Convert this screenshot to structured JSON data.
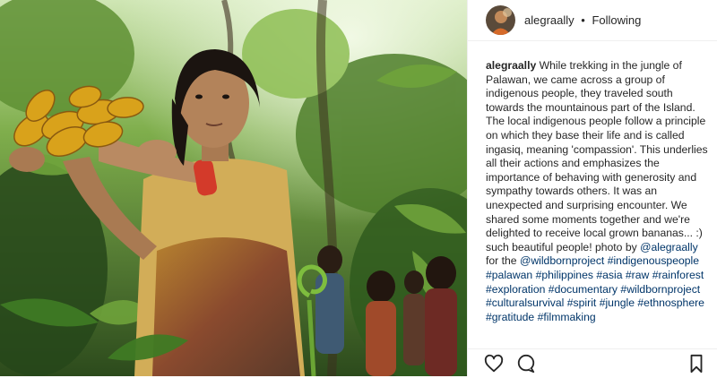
{
  "post": {
    "username": "alegraally",
    "follow_status": "Following",
    "separator": "•"
  },
  "caption": {
    "username": "alegraally",
    "text_a": "While trekking in the jungle of Palawan, we came across a group of indigenous people, they traveled south towards the mountainous part of the Island. The local indigenous people follow a principle on which they base their life and is called ingasiq, meaning 'compassion'. This underlies all their actions and emphasizes the importance of behaving with generosity and sympathy towards others. It was an unexpected and surprising encounter. We shared some moments together and we're delighted to receive local grown bananas... :) such beautiful people! photo by",
    "mention": "@alegraally",
    "text_b": "for the",
    "hashtags": [
      "@wildbornproject",
      "#indigenouspeople",
      "#palawan",
      "#philippines",
      "#asia",
      "#raw",
      "#rainforest",
      "#exploration",
      "#documentary",
      "#wildbornproject",
      "#culturalsurvival",
      "#spirit",
      "#jungle",
      "#ethnosphere",
      "#gratitude",
      "#filmmaking"
    ]
  },
  "icons": {
    "like": "heart-outline-icon",
    "comment": "comment-bubble-icon",
    "save": "bookmark-icon"
  },
  "colors": {
    "text": "#262626",
    "link": "#003569",
    "border": "#efefef",
    "jungle_dark": "#1f3a17",
    "jungle_light": "#9ccc5a",
    "bananas": "#d9a21b"
  }
}
